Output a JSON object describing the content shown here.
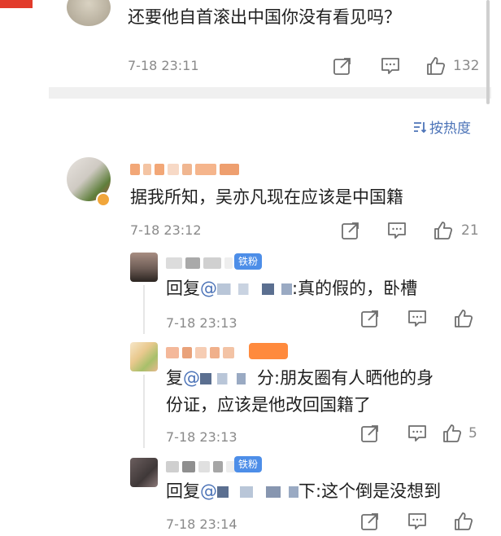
{
  "top_comment": {
    "text": "还要他自首滚出中国你没有看见吗？",
    "time": "7-18 23:11",
    "like_count": "132"
  },
  "sort": {
    "label": "按热度"
  },
  "main_comment": {
    "text": "据我所知，吴亦凡现在应该是中国籍",
    "time": "7-18 23:12",
    "like_count": "21"
  },
  "replies": [
    {
      "badge": "铁粉",
      "prefix": "回复",
      "mention": "@",
      "text": ":真的假的，卧槽",
      "time": "7-18 23:13",
      "like_count": ""
    },
    {
      "badge": "",
      "prefix": "复",
      "mention": "@",
      "text_line1": "分:朋友圈有人晒他的身",
      "text_line2": "份证，应该是他改回国籍了",
      "time": "7-18 23:13",
      "like_count": "5"
    },
    {
      "badge": "铁粉",
      "prefix": "回复",
      "mention": "@",
      "text": "下:这个倒是没想到",
      "time": "7-18 23:14",
      "like_count": ""
    }
  ],
  "colors": {
    "link": "#4d74b8",
    "badge_blue": "#4d8ee8",
    "badge_orange": "#ff8a3d",
    "divider": "#f0f0f0",
    "timestamp": "#8a8a8a"
  },
  "icons": {
    "share": "share-icon",
    "comment": "comment-icon",
    "like": "thumbs-up-icon",
    "sort": "sort-icon",
    "verified": "verified-badge-icon"
  }
}
